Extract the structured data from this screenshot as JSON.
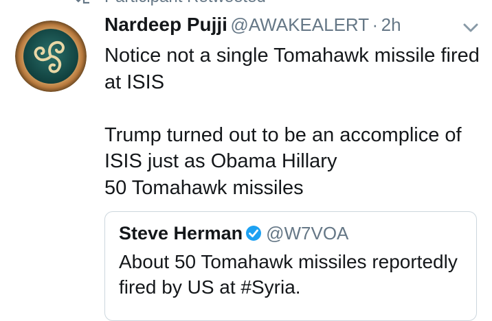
{
  "retweet_context": {
    "text": "Participant Retweeted",
    "icon": "retweet-icon"
  },
  "tweet": {
    "display_name": "Nardeep Pujji",
    "handle": "@AWAKEALERT",
    "separator": "·",
    "time": "2h",
    "text": "Notice not a single Tomahawk missile fired at ISIS\n\nTrump turned out to be an accomplice of ISIS just as Obama Hillary\n50 Tomahawk missiles",
    "menu_icon": "chevron-down-icon"
  },
  "quoted_tweet": {
    "display_name": "Steve Herman",
    "verified_icon": "verified-badge-icon",
    "handle": "@W7VOA",
    "text": "About 50 Tomahawk missiles reportedly fired by US at #Syria."
  },
  "colors": {
    "text_primary": "#14171a",
    "text_secondary": "#657786",
    "verified_blue": "#1da1f2",
    "border": "#ccd6dd"
  }
}
